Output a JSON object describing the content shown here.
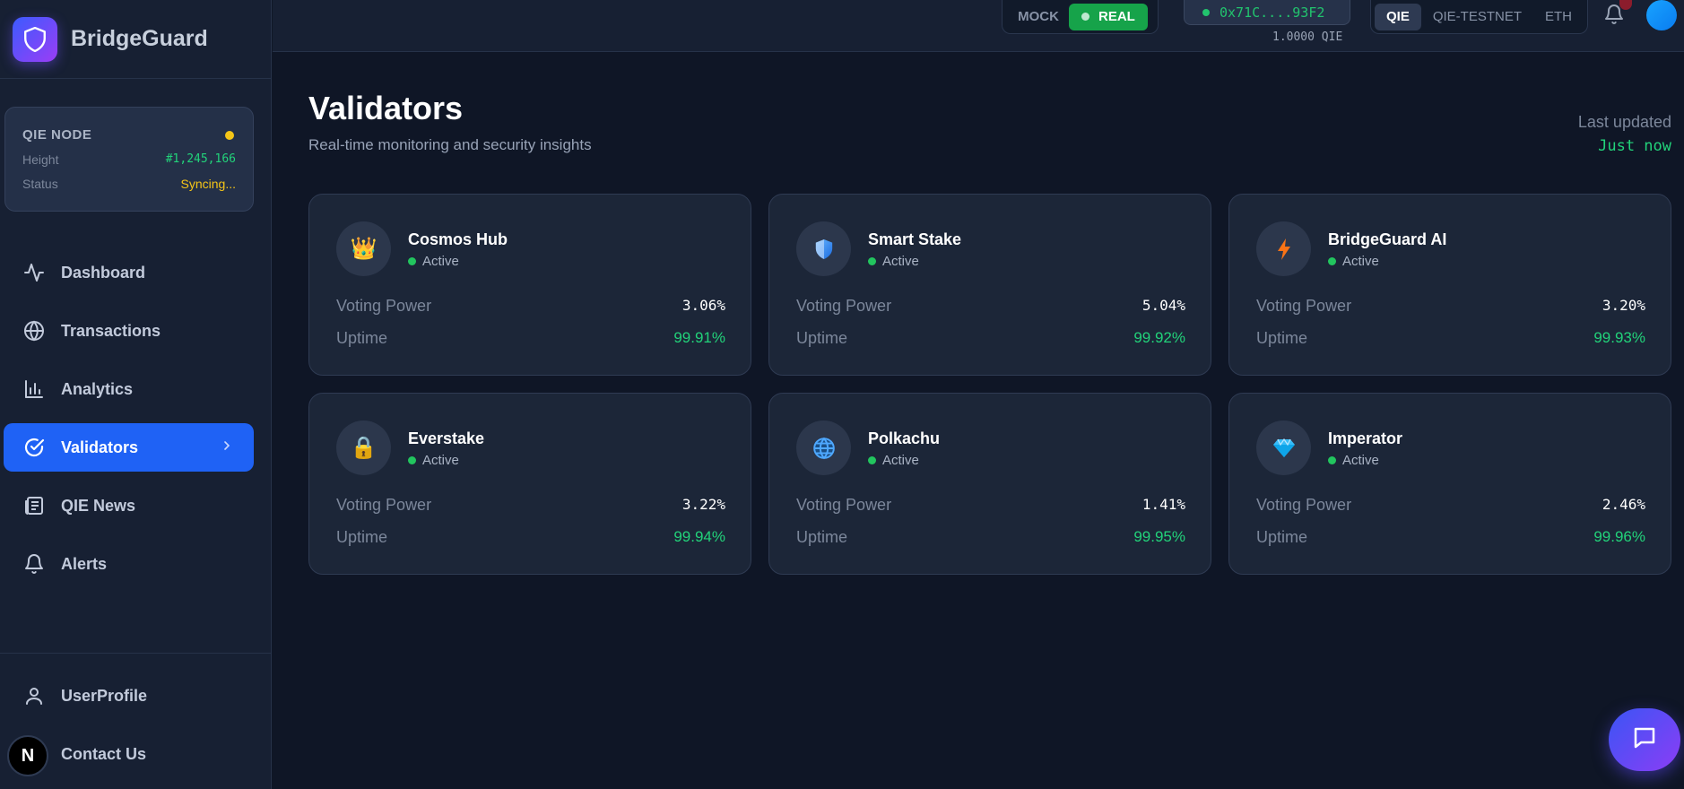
{
  "app": {
    "name": "BridgeGuard"
  },
  "node": {
    "title": "QIE NODE",
    "height_label": "Height",
    "height_value": "#1,245,166",
    "status_label": "Status",
    "status_value": "Syncing..."
  },
  "nav": {
    "items": [
      {
        "label": "Dashboard",
        "icon": "activity-icon"
      },
      {
        "label": "Transactions",
        "icon": "globe-icon"
      },
      {
        "label": "Analytics",
        "icon": "bar-chart-icon"
      },
      {
        "label": "Validators",
        "icon": "check-circle-icon",
        "active": true
      },
      {
        "label": "QIE News",
        "icon": "newspaper-icon"
      },
      {
        "label": "Alerts",
        "icon": "bell-icon"
      }
    ],
    "bottom": [
      {
        "label": "UserProfile",
        "icon": "user-icon"
      },
      {
        "label": "Contact Us",
        "icon": "mail-icon"
      }
    ],
    "badge": "N"
  },
  "topbar": {
    "mode_mock": "MOCK",
    "mode_real": "REAL",
    "wallet": "0x71C....93F2",
    "balance": "1.0000 QIE",
    "networks": [
      "QIE",
      "QIE-TESTNET",
      "ETH"
    ],
    "selected_network": "QIE"
  },
  "page": {
    "title": "Validators",
    "subtitle": "Real-time monitoring and security insights",
    "updated_label": "Last updated",
    "updated_value": "Just now"
  },
  "labels": {
    "voting_power": "Voting Power",
    "uptime": "Uptime",
    "status": "Active"
  },
  "validators": [
    {
      "name": "Cosmos Hub",
      "status": "Active",
      "voting_power": "3.06%",
      "uptime": "99.91%",
      "icon": "👑"
    },
    {
      "name": "Smart Stake",
      "status": "Active",
      "voting_power": "5.04%",
      "uptime": "99.92%",
      "icon": "🛡"
    },
    {
      "name": "BridgeGuard AI",
      "status": "Active",
      "voting_power": "3.20%",
      "uptime": "99.93%",
      "icon": "⚡"
    },
    {
      "name": "Everstake",
      "status": "Active",
      "voting_power": "3.22%",
      "uptime": "99.94%",
      "icon": "🔒"
    },
    {
      "name": "Polkachu",
      "status": "Active",
      "voting_power": "1.41%",
      "uptime": "99.95%",
      "icon": "🌐"
    },
    {
      "name": "Imperator",
      "status": "Active",
      "voting_power": "2.46%",
      "uptime": "99.96%",
      "icon": "💎"
    }
  ],
  "colors": {
    "accent": "#1f62f5",
    "success": "#22d37a",
    "warning": "#f5c518",
    "background": "#0f1626"
  }
}
